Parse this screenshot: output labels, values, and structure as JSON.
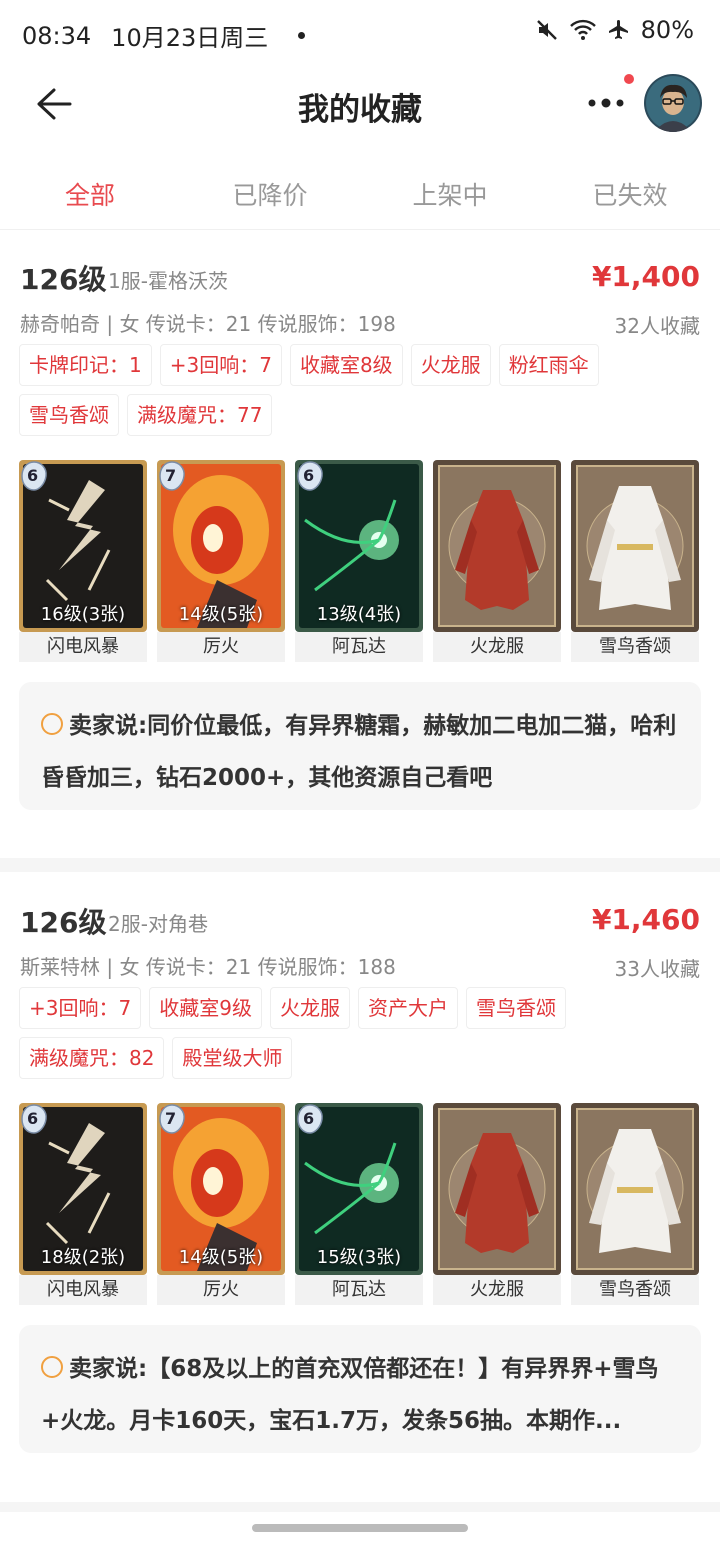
{
  "status_bar": {
    "time": "08:34",
    "date": "10月23日周三",
    "battery": "80%"
  },
  "header": {
    "title": "我的收藏"
  },
  "tabs": [
    "全部",
    "已降价",
    "上架中",
    "已失效"
  ],
  "listings": [
    {
      "level": "126级",
      "server": "1服-霍格沃茨",
      "price": "¥1,400",
      "info": "赫奇帕奇 | 女 传说卡：21 传说服饰：198",
      "favorites": "32人收藏",
      "tags": [
        "卡牌印记：1",
        "+3回响：7",
        "收藏室8级",
        "火龙服",
        "粉红雨伞",
        "雪鸟香颂",
        "满级魔咒：77"
      ],
      "items": [
        {
          "name": "闪电风暴",
          "level": "16级(3张)",
          "badge": "6"
        },
        {
          "name": "厉火",
          "level": "14级(5张)",
          "badge": "7"
        },
        {
          "name": "阿瓦达",
          "level": "13级(4张)",
          "badge": "6"
        },
        {
          "name": "火龙服",
          "level": "",
          "badge": ""
        },
        {
          "name": "雪鸟香颂",
          "level": "",
          "badge": ""
        }
      ],
      "seller_label": "卖家说:",
      "seller_text": "同价位最低，有异界糖霜，赫敏加二电加二猫，哈利昏昏加三，钻石2000+，其他资源自己看吧"
    },
    {
      "level": "126级",
      "server": "2服-对角巷",
      "price": "¥1,460",
      "info": "斯莱特林 | 女 传说卡：21 传说服饰：188",
      "favorites": "33人收藏",
      "tags": [
        "+3回响：7",
        "收藏室9级",
        "火龙服",
        "资产大户",
        "雪鸟香颂",
        "满级魔咒：82",
        "殿堂级大师"
      ],
      "items": [
        {
          "name": "闪电风暴",
          "level": "18级(2张)",
          "badge": "6"
        },
        {
          "name": "厉火",
          "level": "14级(5张)",
          "badge": "7"
        },
        {
          "name": "阿瓦达",
          "level": "15级(3张)",
          "badge": "6"
        },
        {
          "name": "火龙服",
          "level": "",
          "badge": ""
        },
        {
          "name": "雪鸟香颂",
          "level": "",
          "badge": ""
        }
      ],
      "seller_label": "卖家说:",
      "seller_text": "【68及以上的首充双倍都还在！】有异界界+雪鸟+火龙。月卡160天，宝石1.7万，发条56抽。本期作..."
    }
  ],
  "colors": {
    "accent": "#e84a4f",
    "price": "#e0373a"
  }
}
